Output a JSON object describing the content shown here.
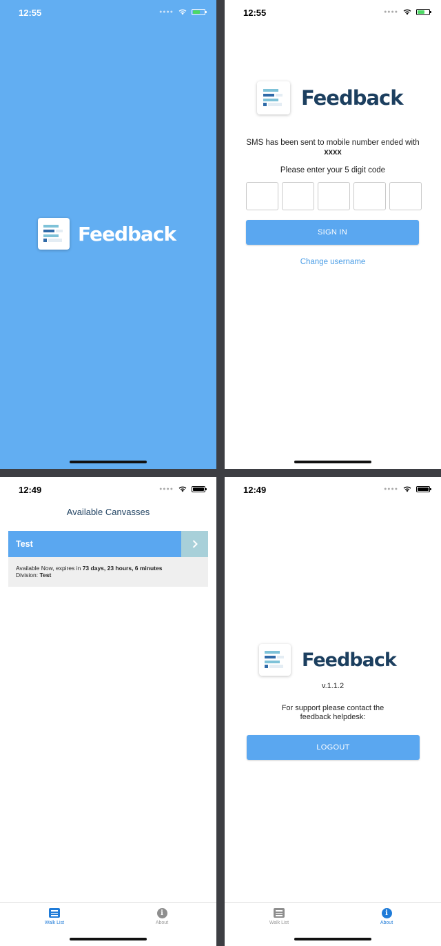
{
  "screens": {
    "splash": {
      "time": "12:55",
      "brand": "Feedback"
    },
    "verify": {
      "time": "12:55",
      "brand": "Feedback",
      "sms_text": "SMS has been sent to mobile number ended with",
      "masked_number": "xxxx",
      "prompt": "Please enter your 5 digit code",
      "code_digits": [
        "",
        "",
        "",
        "",
        ""
      ],
      "signin_label": "SIGN IN",
      "change_link": "Change username"
    },
    "canvasses": {
      "time": "12:49",
      "title": "Available Canvasses",
      "items": [
        {
          "name": "Test",
          "available_prefix": "Available Now, expires in ",
          "expires": "73 days, 23 hours, 6 minutes",
          "division_label": "Division: ",
          "division": "Test"
        }
      ],
      "tabs": [
        {
          "label": "Walk List",
          "icon": "list-icon",
          "active": true
        },
        {
          "label": "About",
          "icon": "info-icon",
          "active": false
        }
      ]
    },
    "about": {
      "time": "12:49",
      "brand": "Feedback",
      "version": "v.1.1.2",
      "support": "For support please contact the feedback helpdesk:",
      "logout_label": "LOGOUT",
      "tabs": [
        {
          "label": "Walk List",
          "icon": "list-icon",
          "active": false
        },
        {
          "label": "About",
          "icon": "info-icon",
          "active": true
        }
      ]
    }
  },
  "colors": {
    "brand_blue": "#62aef2",
    "button_blue": "#5aa7f0",
    "navy": "#1c3f5f",
    "active_tab": "#1f7bd8"
  }
}
